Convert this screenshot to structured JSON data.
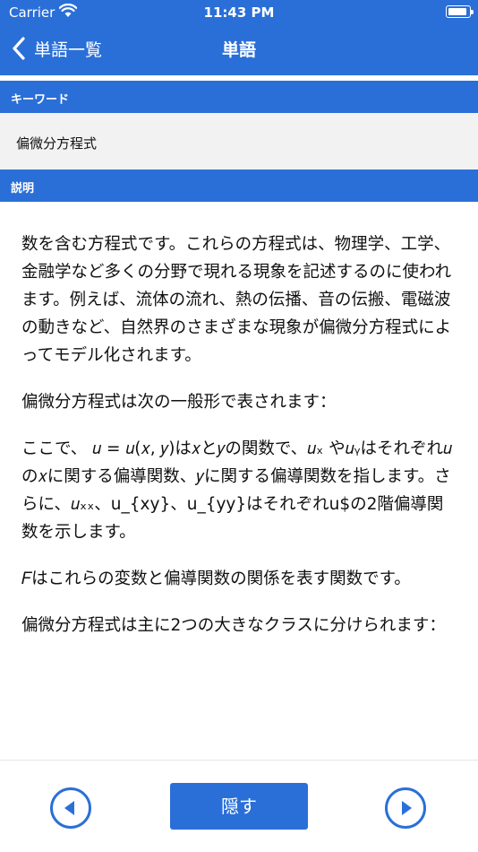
{
  "status_bar": {
    "carrier": "Carrier",
    "time": "11:43 PM"
  },
  "nav": {
    "back_label": "単語一覧",
    "title": "単語"
  },
  "keyword": {
    "label": "キーワード",
    "value": "偏微分方程式"
  },
  "description": {
    "label": "説明",
    "paragraphs": [
      "数を含む方程式です。これらの方程式は、物理学、工学、金融学など多くの分野で現れる現象を記述するのに使われます。例えば、流体の流れ、熱の伝播、音の伝搬、電磁波の動きなど、自然界のさまざまな現象が偏微分方程式によってモデル化されます。",
      "偏微分方程式は次の一般形で表されます：",
      "ここで、 𝑢 = 𝑢(𝑥, 𝑦)は𝑥と𝑦の関数で、𝑢ₓ や𝑢ᵧはそれぞれ𝑢の𝑥に関する偏導関数、𝑦に関する偏導関数を指します。さらに、𝑢ₓₓ、u_{xy}、u_{yy}はそれぞれu$の2階偏導関数を示します。",
      "𝐹はこれらの変数と偏導関数の関係を表す関数です。",
      "偏微分方程式は主に2つの大きなクラスに分けられます："
    ]
  },
  "bottom": {
    "hide_label": "隠す",
    "prev_icon": "arrow-left-circle-icon",
    "next_icon": "arrow-right-circle-icon"
  },
  "colors": {
    "accent": "#2a6fd8",
    "field_background": "#f2f2f2"
  }
}
